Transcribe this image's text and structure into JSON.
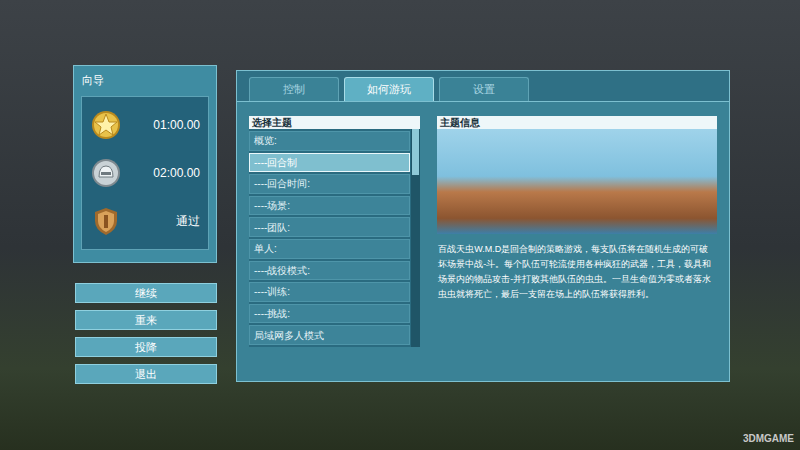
{
  "guide": {
    "title": "向导",
    "medals": [
      {
        "kind": "gold",
        "time": "01:00.00"
      },
      {
        "kind": "silver",
        "time": "02:00.00"
      },
      {
        "kind": "bronze",
        "time": "通过"
      }
    ]
  },
  "menu_buttons": [
    "继续",
    "重来",
    "投降",
    "退出"
  ],
  "tabs": [
    {
      "label": "控制",
      "selected": false
    },
    {
      "label": "如何游玩",
      "selected": true
    },
    {
      "label": "设置",
      "selected": false
    }
  ],
  "topics": {
    "title": "选择主题",
    "scroll_position": 0,
    "items": [
      {
        "label": "概览:",
        "selected": false
      },
      {
        "label": "----回合制",
        "selected": true
      },
      {
        "label": "----回合时间:",
        "selected": false
      },
      {
        "label": "----场景:",
        "selected": false
      },
      {
        "label": "----团队:",
        "selected": false
      },
      {
        "label": "单人:",
        "selected": false
      },
      {
        "label": "----战役模式:",
        "selected": false
      },
      {
        "label": "----训练:",
        "selected": false
      },
      {
        "label": "----挑战:",
        "selected": false
      },
      {
        "label": "局域网多人模式",
        "selected": false
      }
    ]
  },
  "topic_info": {
    "title": "主题信息",
    "text": "百战天虫W.M.D是回合制的策略游戏，每支队伍将在随机生成的可破坏场景中战-斗。每个队伍可轮流使用各种疯狂的武器，工具，载具和场景内的物品攻击-并打败其他队伍的虫虫。一旦生命值为零或者落水虫虫就将死亡，最后一支留在场上的队伍将获得胜利。"
  },
  "watermark": "3DMGAME"
}
